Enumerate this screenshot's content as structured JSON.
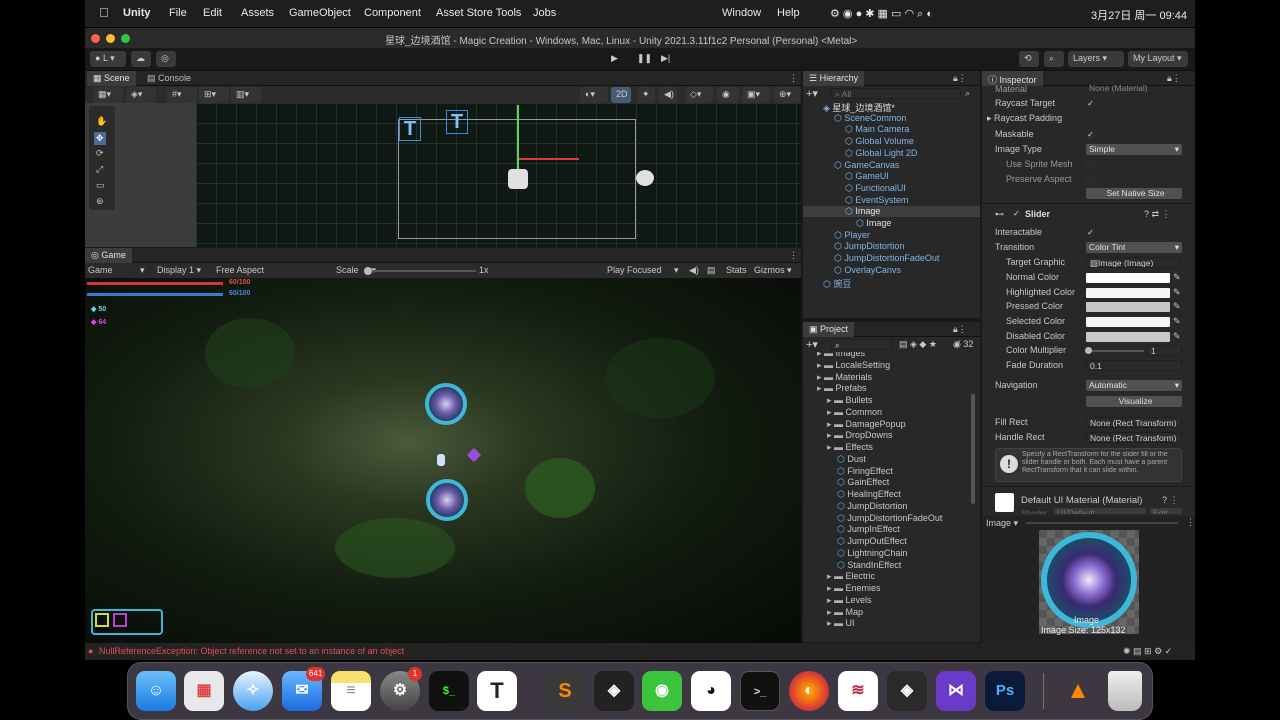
{
  "menubar": {
    "app": "Unity",
    "items": [
      "File",
      "Edit",
      "Assets",
      "GameObject",
      "Component",
      "Asset Store Tools",
      "Jobs"
    ],
    "right": [
      "Window",
      "Help"
    ],
    "datetime": "3月27日 周一 09:44"
  },
  "window": {
    "title": "星球_边境酒馆 - Magic Creation - Windows, Mac, Linux - Unity 2021.3.11f1c2 Personal (Personal) <Metal>"
  },
  "toolbar": {
    "account": "L",
    "layers": "Layers",
    "layout": "My Layout"
  },
  "scene": {
    "tabs": [
      "Scene",
      "Console"
    ],
    "mode_2d": "2D",
    "handle": "0"
  },
  "game": {
    "tab": "Game",
    "display": "Game",
    "display_num": "Display 1",
    "aspect": "Free Aspect",
    "scale_label": "Scale",
    "scale_value": "1x",
    "play_focused": "Play Focused",
    "stats": "Stats",
    "gizmos": "Gizmos",
    "hp": "60/100",
    "mp": "60/100",
    "stat1": "50",
    "stat2": "64"
  },
  "hierarchy": {
    "title": "Hierarchy",
    "search": "All",
    "items": [
      {
        "label": "星球_边境酒馆*",
        "indent": 0,
        "color": "#e0e0e0"
      },
      {
        "label": "SceneCommon",
        "indent": 1,
        "color": "#7fb7e8"
      },
      {
        "label": "Main Camera",
        "indent": 2,
        "color": "#7fb7e8"
      },
      {
        "label": "Global Volume",
        "indent": 2,
        "color": "#7fb7e8"
      },
      {
        "label": "Global Light 2D",
        "indent": 2,
        "color": "#7fb7e8"
      },
      {
        "label": "GameCanvas",
        "indent": 1,
        "color": "#7fb7e8"
      },
      {
        "label": "GameUI",
        "indent": 2,
        "color": "#7fb7e8"
      },
      {
        "label": "FunctionalUI",
        "indent": 2,
        "color": "#7fb7e8"
      },
      {
        "label": "EventSystem",
        "indent": 2,
        "color": "#7fb7e8"
      },
      {
        "label": "Image",
        "indent": 2,
        "color": "#e0e0e0"
      },
      {
        "label": "Image",
        "indent": 3,
        "color": "#e0e0e0"
      },
      {
        "label": "Player",
        "indent": 1,
        "color": "#7fb7e8"
      },
      {
        "label": "JumpDistortion",
        "indent": 1,
        "color": "#7fb7e8"
      },
      {
        "label": "JumpDistortionFadeOut",
        "indent": 1,
        "color": "#7fb7e8"
      },
      {
        "label": "OverlayCanvs",
        "indent": 1,
        "color": "#7fb7e8"
      },
      {
        "label": "豌豆",
        "indent": 0,
        "color": "#7fb7e8"
      }
    ]
  },
  "project": {
    "title": "Project",
    "count": "32",
    "items": [
      {
        "label": "Images",
        "indent": 1,
        "folder": true
      },
      {
        "label": "LocaleSetting",
        "indent": 1,
        "folder": true
      },
      {
        "label": "Materials",
        "indent": 1,
        "folder": true
      },
      {
        "label": "Prefabs",
        "indent": 1,
        "folder": true
      },
      {
        "label": "Bullets",
        "indent": 2,
        "folder": true
      },
      {
        "label": "Common",
        "indent": 2,
        "folder": true
      },
      {
        "label": "DamagePopup",
        "indent": 2,
        "folder": true
      },
      {
        "label": "DropDowns",
        "indent": 2,
        "folder": true
      },
      {
        "label": "Effects",
        "indent": 2,
        "folder": true
      },
      {
        "label": "Dust",
        "indent": 3,
        "folder": false
      },
      {
        "label": "FiringEffect",
        "indent": 3,
        "folder": false
      },
      {
        "label": "GainEffect",
        "indent": 3,
        "folder": false
      },
      {
        "label": "HealingEffect",
        "indent": 3,
        "folder": false
      },
      {
        "label": "JumpDistortion",
        "indent": 3,
        "folder": false
      },
      {
        "label": "JumpDistortionFadeOut",
        "indent": 3,
        "folder": false
      },
      {
        "label": "JumpInEffect",
        "indent": 3,
        "folder": false
      },
      {
        "label": "JumpOutEffect",
        "indent": 3,
        "folder": false
      },
      {
        "label": "LightningChain",
        "indent": 3,
        "folder": false
      },
      {
        "label": "StandInEffect",
        "indent": 3,
        "folder": false
      },
      {
        "label": "Electric",
        "indent": 2,
        "folder": true
      },
      {
        "label": "Enemies",
        "indent": 2,
        "folder": true
      },
      {
        "label": "Levels",
        "indent": 2,
        "folder": true
      },
      {
        "label": "Map",
        "indent": 2,
        "folder": true
      },
      {
        "label": "UI",
        "indent": 2,
        "folder": true
      }
    ]
  },
  "inspector": {
    "title": "Inspector",
    "material_label": "Material",
    "material_value": "None (Material)",
    "raycast_target": "Raycast Target",
    "raycast_padding": "Raycast Padding",
    "maskable": "Maskable",
    "image_type_label": "Image Type",
    "image_type_value": "Simple",
    "use_sprite_mesh": "Use Sprite Mesh",
    "preserve_aspect": "Preserve Aspect",
    "set_native_size": "Set Native Size",
    "slider_title": "Slider",
    "interactable": "Interactable",
    "transition_label": "Transition",
    "transition_value": "Color Tint",
    "target_graphic_label": "Target Graphic",
    "target_graphic_value": "Image (Image)",
    "colors": [
      {
        "label": "Normal Color",
        "color": "#ffffff"
      },
      {
        "label": "Highlighted Color",
        "color": "#f5f5f5"
      },
      {
        "label": "Pressed Color",
        "color": "#c8c8c8"
      },
      {
        "label": "Selected Color",
        "color": "#f5f5f5"
      },
      {
        "label": "Disabled Color",
        "color": "#c8c8c8"
      }
    ],
    "color_multiplier_label": "Color Multiplier",
    "color_multiplier_value": "1",
    "fade_duration_label": "Fade Duration",
    "fade_duration_value": "0.1",
    "navigation_label": "Navigation",
    "navigation_value": "Automatic",
    "visualize": "Visualize",
    "fill_rect_label": "Fill Rect",
    "fill_rect_value": "None (Rect Transform)",
    "handle_rect_label": "Handle Rect",
    "handle_rect_value": "None (Rect Transform)",
    "help": "Specify a RectTransform for the slider fill or the slider handle or both. Each must have a parent RectTransform that it can slide within.",
    "default_material": "Default UI Material (Material)",
    "shader": "Shader",
    "shader_value": "UI/Default",
    "edit": "Edit",
    "preview_label": "Image",
    "preview_name": "Image",
    "preview_size": "Image Size: 125x132"
  },
  "statusbar": {
    "error": "NullReferenceException: Object reference not set to an instance of an object"
  },
  "dock": {
    "mail_badge": "641",
    "settings_badge": "1"
  }
}
